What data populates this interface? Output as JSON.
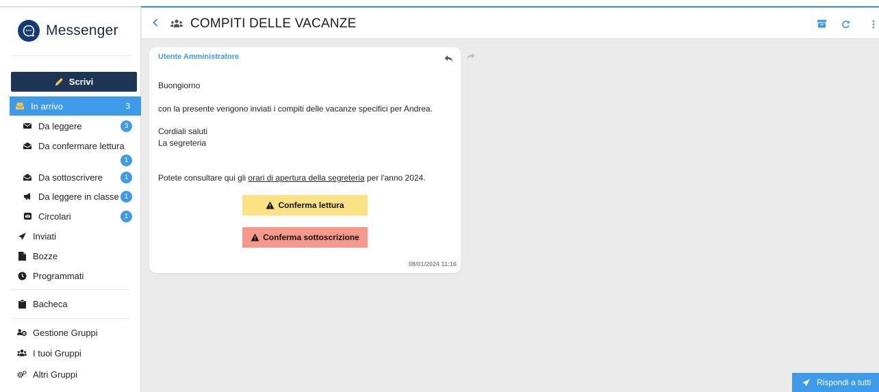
{
  "app": {
    "name": "Messenger"
  },
  "sidebar": {
    "compose_label": "Scrivi",
    "inbox": {
      "label": "In arrivo",
      "count": "3"
    },
    "inbox_items": [
      {
        "label": "Da leggere",
        "count": "3",
        "icon": "envelope-icon"
      },
      {
        "label": "Da confermare lettura",
        "count": "1",
        "icon": "envelope-open-icon"
      },
      {
        "label": "Da sottoscrivere",
        "count": "1",
        "icon": "envelope-open-icon"
      },
      {
        "label": "Da leggere in classe",
        "count": "1",
        "icon": "bullhorn-icon"
      },
      {
        "label": "Circolari",
        "count": "1",
        "icon": "mail-bulk-icon"
      }
    ],
    "sent_label": "Inviati",
    "drafts_label": "Bozze",
    "scheduled_label": "Programmati",
    "board_label": "Bacheca",
    "groups_manage_label": "Gestione Gruppi",
    "my_groups_label": "I tuoi Gruppi",
    "other_groups_label": "Altri Gruppi"
  },
  "header": {
    "title": "COMPITI DELLE VACANZE"
  },
  "message": {
    "sender": "Utente Amministratore",
    "greeting": "Buongiorno",
    "body": "con la presente vengono inviati i compiti delle vacanze specifici per Andrea.",
    "closing1": "Cordiali saluti",
    "closing2": "La segreteria",
    "info_prefix": "Potete consultare qui gli ",
    "info_link": "orari di apertura della segreteria",
    "info_suffix": " per l'anno 2024.",
    "confirm_read_label": "Conferma lettura",
    "confirm_sign_label": "Conferma sottoscrizione",
    "timestamp": "08/01/2024 11:16"
  },
  "reply_all_label": "Rispondi a tutti",
  "colors": {
    "accent": "#3d9be9",
    "navy": "#1e3556",
    "yellow": "#fbe385",
    "red": "#f6988a"
  }
}
